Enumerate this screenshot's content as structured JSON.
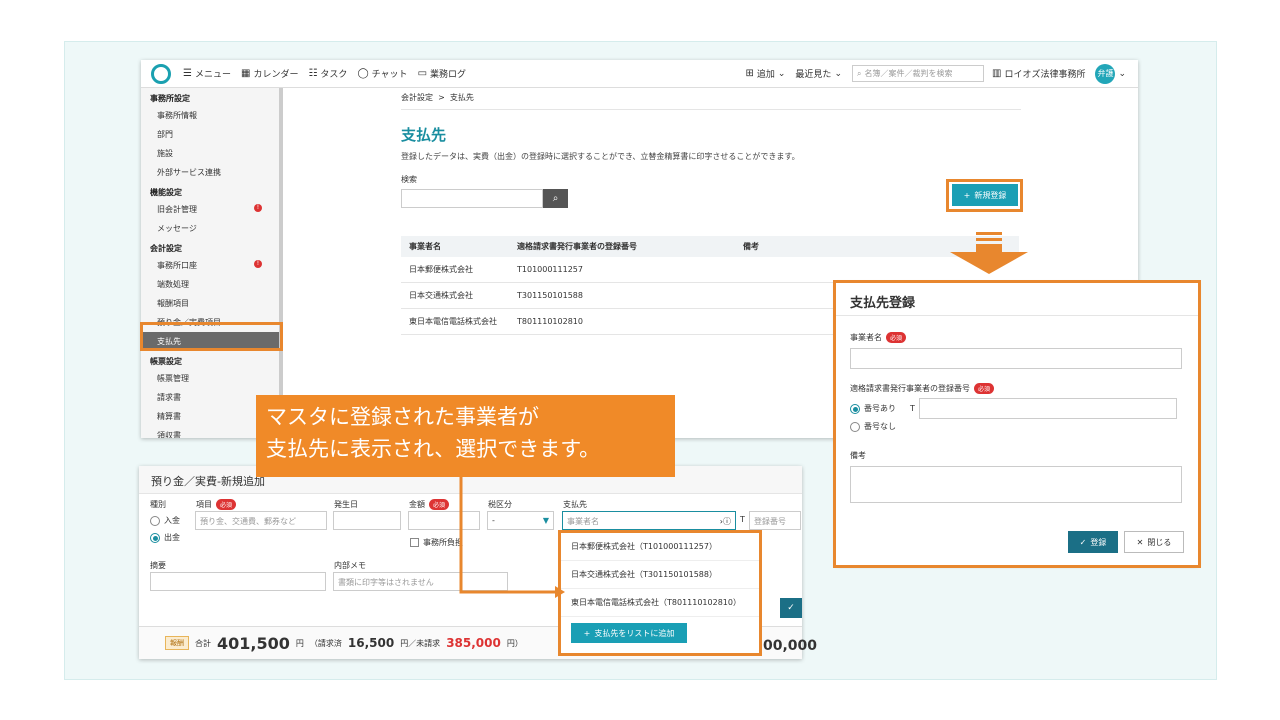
{
  "topbar": {
    "menu": "メニュー",
    "calendar": "カレンダー",
    "task": "タスク",
    "chat": "チャット",
    "worklog": "業務ログ",
    "add": "追加",
    "recent": "最近見た",
    "search_placeholder": "名簿／案件／裁判を検索",
    "office": "ロイオズ法律事務所",
    "avatar": "弁護"
  },
  "sidebar": {
    "sections": [
      {
        "title": "事務所設定",
        "items": [
          "事務所情報",
          "部門",
          "施設",
          "外部サービス連携"
        ]
      },
      {
        "title": "機能設定",
        "items": [
          "旧会計管理",
          "メッセージ"
        ]
      },
      {
        "title": "会計設定",
        "items": [
          "事務所口座",
          "端数処理",
          "報酬項目",
          "預り金／実費項目",
          "支払先"
        ]
      },
      {
        "title": "帳票設定",
        "items": [
          "帳票管理",
          "請求書",
          "精算書",
          "領収書"
        ]
      }
    ],
    "badges": [
      "!",
      "!"
    ]
  },
  "main": {
    "breadcrumb_parent": "会計設定",
    "breadcrumb_sep": ">",
    "breadcrumb_current": "支払先",
    "title": "支払先",
    "description": "登録したデータは、実費（出金）の登録時に選択することができ、立替金精算書に印字させることができます。",
    "search_label": "検索",
    "new_button": "新規登録",
    "columns": [
      "事業者名",
      "適格請求書発行事業者の登録番号",
      "備考"
    ],
    "rows": [
      {
        "name": "日本郵便株式会社",
        "number": "T101000111257",
        "note": ""
      },
      {
        "name": "日本交通株式会社",
        "number": "T301150101588",
        "note": ""
      },
      {
        "name": "東日本電信電話株式会社",
        "number": "T801110102810",
        "note": ""
      }
    ]
  },
  "dialog": {
    "title": "支払先登録",
    "name_label": "事業者名",
    "required": "必須",
    "number_label": "適格請求書発行事業者の登録番号",
    "has_number": "番号あり",
    "t_prefix": "T",
    "no_number": "番号なし",
    "note_label": "備考",
    "submit": "登録",
    "close": "閉じる"
  },
  "callout": {
    "line1": "マスタに登録された事業者が",
    "line2": "支払先に表示され、選択できます。"
  },
  "form": {
    "title": "預り金／実費-新規追加",
    "type_label": "種別",
    "type_in": "入金",
    "type_out": "出金",
    "item_label": "項目",
    "item_placeholder": "預り金、交通費、郵券など",
    "date_label": "発生日",
    "amount_label": "金額",
    "tax_label": "税区分",
    "tax_value": "-",
    "payee_label": "支払先",
    "payee_placeholder": "事業者名",
    "t_prefix": "T",
    "reg_placeholder": "登録番号",
    "office_burden": "事務所負担",
    "summary_label": "摘要",
    "memo_label": "内部メモ",
    "memo_placeholder": "書類に印字等はされません",
    "dropdown": [
      "日本郵便株式会社（T101000111257）",
      "日本交通株式会社（T301150101588）",
      "東日本電信電話株式会社（T801110102810）"
    ],
    "add_to_list": "支払先をリストに追加"
  },
  "footer": {
    "tag": "報酬",
    "total_label": "合計",
    "total": "401,500",
    "yen": "円",
    "billed_label": "（請求済",
    "billed": "16,500",
    "unbilled_label": "円／未請求",
    "unbilled": "385,000",
    "close_paren": "円）",
    "right_amount": "00,000"
  }
}
